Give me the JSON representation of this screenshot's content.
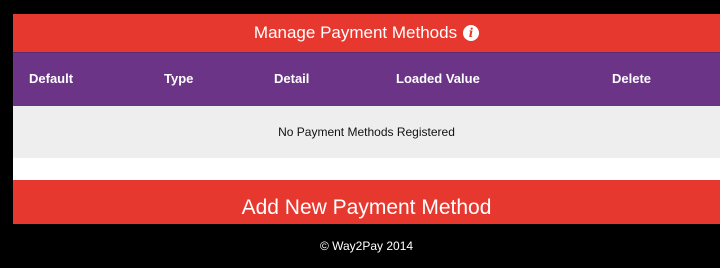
{
  "header": {
    "title": "Manage Payment Methods",
    "info_icon": "info-icon"
  },
  "table": {
    "columns": [
      "Default",
      "Type",
      "Detail",
      "Loaded Value",
      "Delete"
    ],
    "empty_message": "No Payment Methods Registered"
  },
  "actions": {
    "add_label": "Add New Payment Method"
  },
  "footer": {
    "copyright": "© Way2Pay 2014"
  },
  "colors": {
    "primary_red": "#e7382f",
    "header_purple": "#6b3487",
    "row_gray": "#eeeeee",
    "background": "#000000"
  }
}
